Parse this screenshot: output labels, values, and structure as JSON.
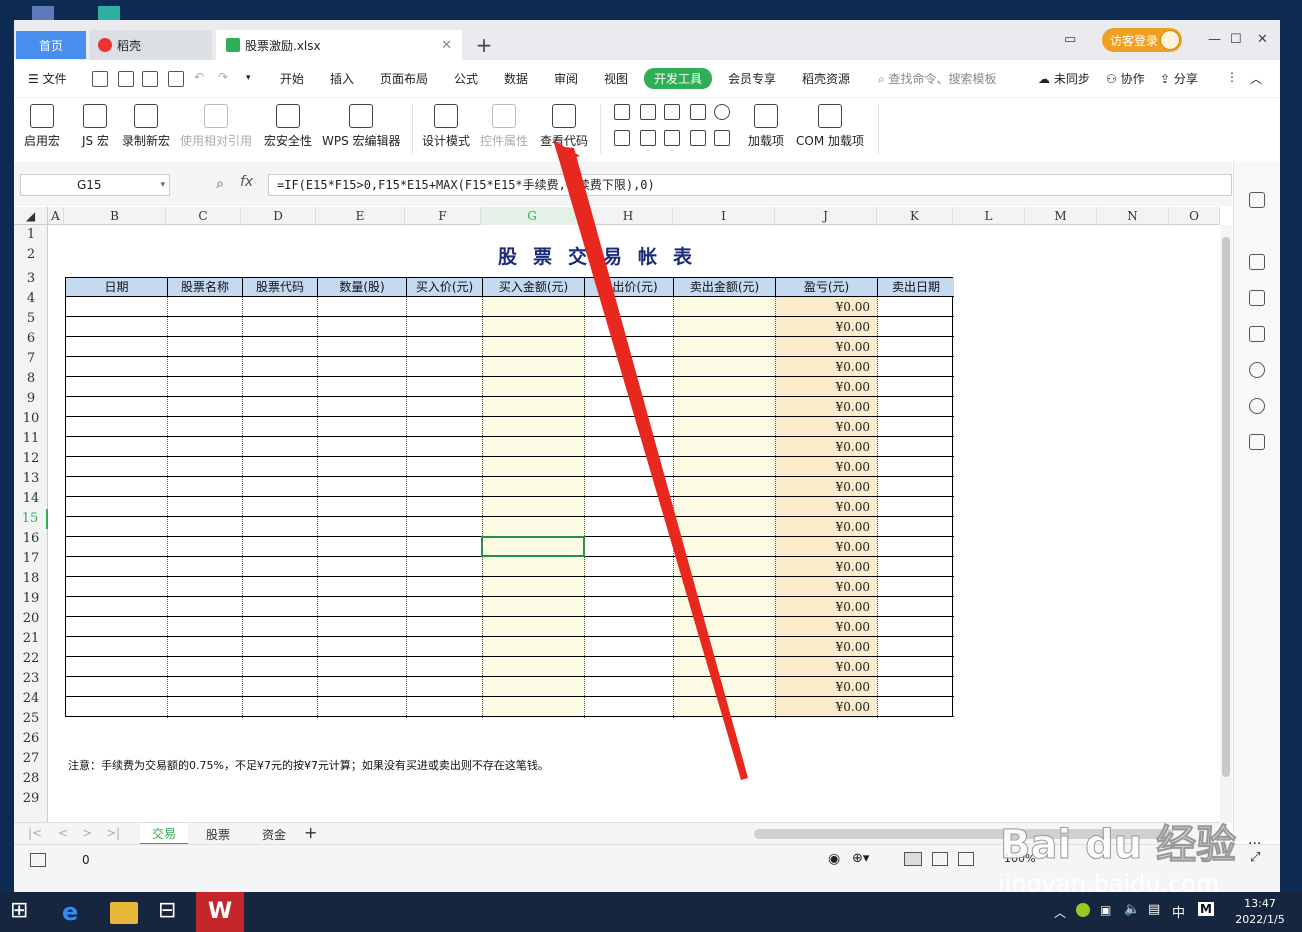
{
  "tabs": {
    "home": "首页",
    "doc": "稻壳",
    "file": "股票激励.xlsx"
  },
  "account": {
    "login": "访客登录"
  },
  "menu": {
    "file": "文件",
    "items": [
      "开始",
      "插入",
      "页面布局",
      "公式",
      "数据",
      "审阅",
      "视图",
      "开发工具",
      "会员专享",
      "稻壳资源"
    ],
    "search": "查找命令、搜索模板",
    "sync": "未同步",
    "collab": "协作",
    "share": "分享"
  },
  "ribbon": {
    "buttons": [
      "启用宏",
      "JS 宏",
      "录制新宏",
      "使用相对引用",
      "宏安全性",
      "WPS 宏编辑器",
      "设计模式",
      "控件属性",
      "查看代码",
      "加载项",
      "COM 加载项"
    ]
  },
  "formula_bar": {
    "cell": "G15",
    "fx": "fx",
    "formula": "=IF(E15*F15>0,F15*E15+MAX(F15*E15*手续费,手续费下限),0)"
  },
  "columns": [
    "A",
    "B",
    "C",
    "D",
    "E",
    "F",
    "G",
    "H",
    "I",
    "J",
    "K",
    "L",
    "M",
    "N",
    "O"
  ],
  "rows": [
    "1",
    "2",
    "3",
    "4",
    "5",
    "6",
    "7",
    "8",
    "9",
    "10",
    "11",
    "12",
    "13",
    "14",
    "15",
    "16",
    "17",
    "18",
    "19",
    "20",
    "21",
    "22",
    "23",
    "24",
    "25",
    "26",
    "27",
    "28",
    "29"
  ],
  "sheet": {
    "title": "股票交易帐表",
    "headers": [
      "日期",
      "股票名称",
      "股票代码",
      "数量(股)",
      "买入价(元)",
      "买入金额(元)",
      "卖出价(元)",
      "卖出金额(元)",
      "盈亏(元)",
      "卖出日期"
    ],
    "pl_values": [
      "¥0.00",
      "¥0.00",
      "¥0.00",
      "¥0.00",
      "¥0.00",
      "¥0.00",
      "¥0.00",
      "¥0.00",
      "¥0.00",
      "¥0.00",
      "¥0.00",
      "¥0.00",
      "¥0.00",
      "¥0.00",
      "¥0.00",
      "¥0.00",
      "¥0.00",
      "¥0.00",
      "¥0.00",
      "¥0.00",
      "¥0.00"
    ],
    "note": "注意：手续费为交易额的0.75%，不足¥7元的按¥7元计算；如果没有买进或卖出则不存在这笔钱。"
  },
  "sheet_tabs": [
    "交易",
    "股票",
    "资金"
  ],
  "status": {
    "value": "0",
    "zoom": "100%"
  },
  "taskbar": {
    "time": "13:47",
    "date": "2022/1/5",
    "ime": "中",
    "ime2": "M"
  },
  "watermark": {
    "logo": "Bai du 经验",
    "url": "jingyan.baidu.com"
  },
  "colors": {
    "accent": "#2fae55",
    "header_fill": "#c5d9f1",
    "buy_fill": "#fbfbe3",
    "pl_fill": "#fbeccb",
    "arrow": "#e8281e"
  }
}
